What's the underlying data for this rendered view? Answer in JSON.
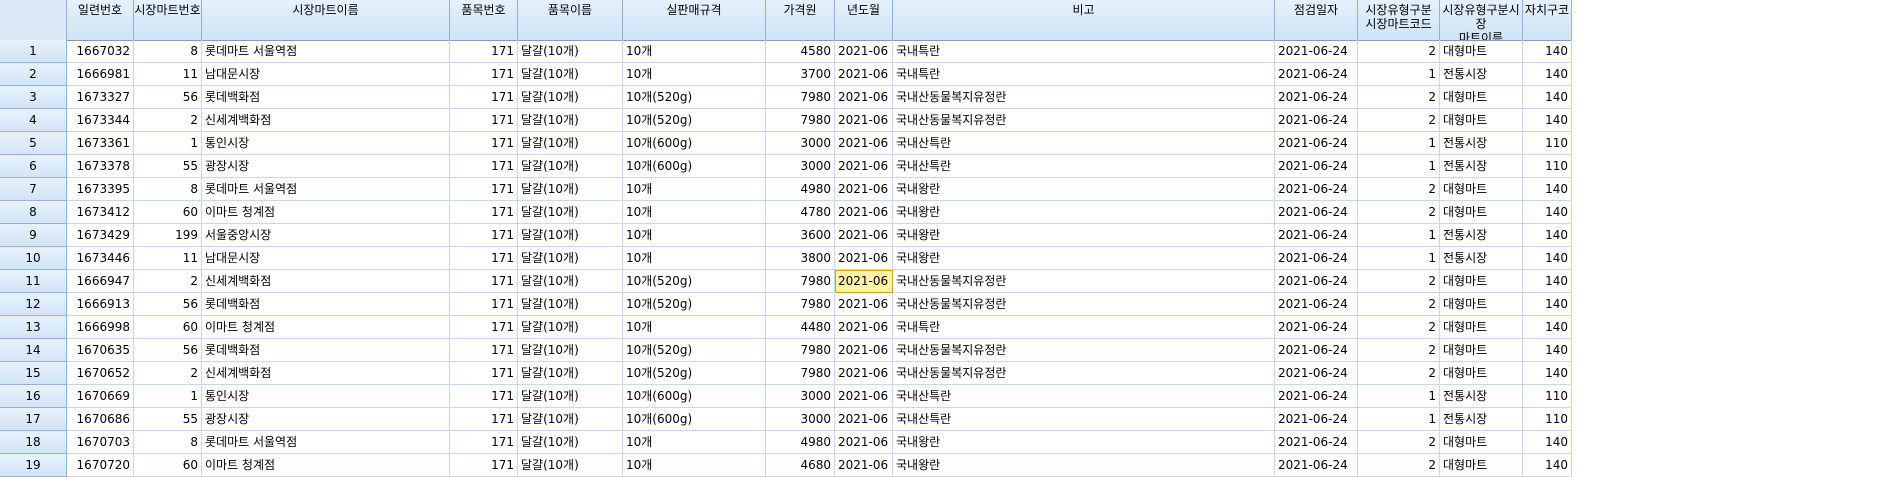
{
  "columns": [
    "",
    "일련번호",
    "시장마트번호",
    "시장마트이름",
    "품목번호",
    "품목이름",
    "실판매규격",
    "가격원",
    "년도월",
    "비고",
    "점검일자",
    "시장유형구분\n시장마트코드",
    "시장유형구분시장\n마트이름",
    "자치구코"
  ],
  "rows": [
    [
      "1",
      "1667032",
      "8",
      "롯데마트 서울역점",
      "171",
      "달걀(10개)",
      "10개",
      "4580",
      "2021-06",
      "국내특란",
      "2021-06-24",
      "2",
      "대형마트",
      "140"
    ],
    [
      "2",
      "1666981",
      "11",
      "남대문시장",
      "171",
      "달걀(10개)",
      "10개",
      "3700",
      "2021-06",
      "국내특란",
      "2021-06-24",
      "1",
      "전통시장",
      "140"
    ],
    [
      "3",
      "1673327",
      "56",
      "롯데백화점",
      "171",
      "달걀(10개)",
      "10개(520g)",
      "7980",
      "2021-06",
      "국내산동물복지유정란",
      "2021-06-24",
      "2",
      "대형마트",
      "140"
    ],
    [
      "4",
      "1673344",
      "2",
      "신세계백화점",
      "171",
      "달걀(10개)",
      "10개(520g)",
      "7980",
      "2021-06",
      "국내산동물복지유정란",
      "2021-06-24",
      "2",
      "대형마트",
      "140"
    ],
    [
      "5",
      "1673361",
      "1",
      "통인시장",
      "171",
      "달걀(10개)",
      "10개(600g)",
      "3000",
      "2021-06",
      "국내산특란",
      "2021-06-24",
      "1",
      "전통시장",
      "110"
    ],
    [
      "6",
      "1673378",
      "55",
      "광장시장",
      "171",
      "달걀(10개)",
      "10개(600g)",
      "3000",
      "2021-06",
      "국내산특란",
      "2021-06-24",
      "1",
      "전통시장",
      "110"
    ],
    [
      "7",
      "1673395",
      "8",
      "롯데마트 서울역점",
      "171",
      "달걀(10개)",
      "10개",
      "4980",
      "2021-06",
      "국내왕란",
      "2021-06-24",
      "2",
      "대형마트",
      "140"
    ],
    [
      "8",
      "1673412",
      "60",
      "이마트 청계점",
      "171",
      "달걀(10개)",
      "10개",
      "4780",
      "2021-06",
      "국내왕란",
      "2021-06-24",
      "2",
      "대형마트",
      "140"
    ],
    [
      "9",
      "1673429",
      "199",
      "서울중앙시장",
      "171",
      "달걀(10개)",
      "10개",
      "3600",
      "2021-06",
      "국내왕란",
      "2021-06-24",
      "1",
      "전통시장",
      "140"
    ],
    [
      "10",
      "1673446",
      "11",
      "남대문시장",
      "171",
      "달걀(10개)",
      "10개",
      "3800",
      "2021-06",
      "국내왕란",
      "2021-06-24",
      "1",
      "전통시장",
      "140"
    ],
    [
      "11",
      "1666947",
      "2",
      "신세계백화점",
      "171",
      "달걀(10개)",
      "10개(520g)",
      "7980",
      "2021-06",
      "국내산동물복지유정란",
      "2021-06-24",
      "2",
      "대형마트",
      "140"
    ],
    [
      "12",
      "1666913",
      "56",
      "롯데백화점",
      "171",
      "달걀(10개)",
      "10개(520g)",
      "7980",
      "2021-06",
      "국내산동물복지유정란",
      "2021-06-24",
      "2",
      "대형마트",
      "140"
    ],
    [
      "13",
      "1666998",
      "60",
      "이마트 청계점",
      "171",
      "달걀(10개)",
      "10개",
      "4480",
      "2021-06",
      "국내특란",
      "2021-06-24",
      "2",
      "대형마트",
      "140"
    ],
    [
      "14",
      "1670635",
      "56",
      "롯데백화점",
      "171",
      "달걀(10개)",
      "10개(520g)",
      "7980",
      "2021-06",
      "국내산동물복지유정란",
      "2021-06-24",
      "2",
      "대형마트",
      "140"
    ],
    [
      "15",
      "1670652",
      "2",
      "신세계백화점",
      "171",
      "달걀(10개)",
      "10개(520g)",
      "7980",
      "2021-06",
      "국내산동물복지유정란",
      "2021-06-24",
      "2",
      "대형마트",
      "140"
    ],
    [
      "16",
      "1670669",
      "1",
      "통인시장",
      "171",
      "달걀(10개)",
      "10개(600g)",
      "3000",
      "2021-06",
      "국내산특란",
      "2021-06-24",
      "1",
      "전통시장",
      "110"
    ],
    [
      "17",
      "1670686",
      "55",
      "광장시장",
      "171",
      "달걀(10개)",
      "10개(600g)",
      "3000",
      "2021-06",
      "국내산특란",
      "2021-06-24",
      "1",
      "전통시장",
      "110"
    ],
    [
      "18",
      "1670703",
      "8",
      "롯데마트 서울역점",
      "171",
      "달걀(10개)",
      "10개",
      "4980",
      "2021-06",
      "국내왕란",
      "2021-06-24",
      "2",
      "대형마트",
      "140"
    ],
    [
      "19",
      "1670720",
      "60",
      "이마트 청계점",
      "171",
      "달걀(10개)",
      "10개",
      "4680",
      "2021-06",
      "국내왕란",
      "2021-06-24",
      "2",
      "대형마트",
      "140"
    ]
  ],
  "selected_cell": {
    "row": 10,
    "col": 8
  },
  "colors": {
    "header_bg": "#d6e6f8",
    "grid_line": "#c5d8ee",
    "selected_bg": "#fff1a8"
  }
}
